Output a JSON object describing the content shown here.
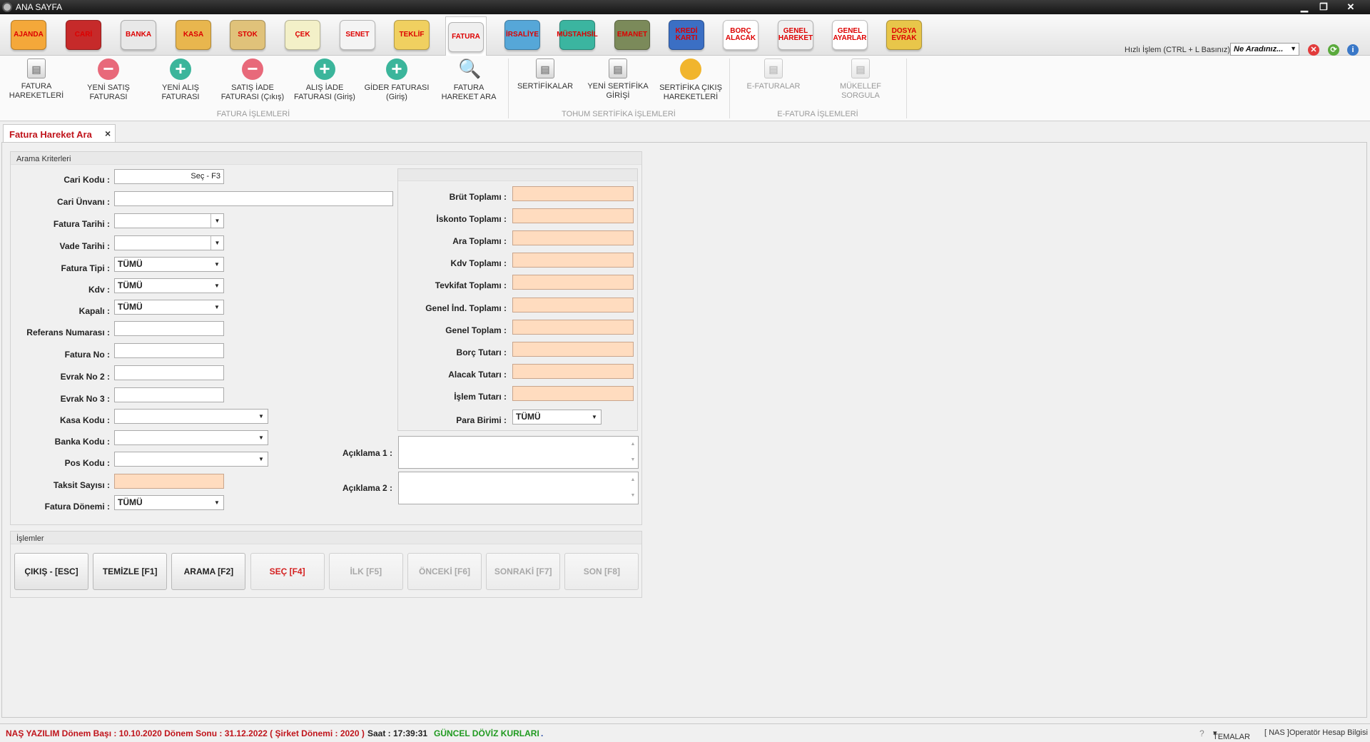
{
  "window": {
    "title": "ANA SAYFA",
    "min": "▁",
    "restore": "❐",
    "close": "✕"
  },
  "modules": [
    {
      "label": "AJANDA",
      "icon": "agenda-icon",
      "color": "#f4a83a"
    },
    {
      "label": "CARİ",
      "icon": "cari-icon",
      "color": "#c62a2a"
    },
    {
      "label": "BANKA",
      "icon": "bank-icon",
      "color": "#e8e8e8"
    },
    {
      "label": "KASA",
      "icon": "cashbox-icon",
      "color": "#e8b64e"
    },
    {
      "label": "STOK",
      "icon": "stock-icon",
      "color": "#e0c27a"
    },
    {
      "label": "ÇEK",
      "icon": "cheque-icon",
      "color": "#f3f0c8"
    },
    {
      "label": "SENET",
      "icon": "note-icon",
      "color": "#f4f4f4"
    },
    {
      "label": "TEKLİF",
      "icon": "offer-icon",
      "color": "#f0d060"
    },
    {
      "label": "FATURA",
      "icon": "invoice-icon",
      "color": "#efefef"
    },
    {
      "label": "İRSALİYE",
      "icon": "waybill-icon",
      "color": "#56a7d8"
    },
    {
      "label": "MÜSTAHSİL",
      "icon": "producer-icon",
      "color": "#3bb5a0"
    },
    {
      "label": "EMANET",
      "icon": "deposit-icon",
      "color": "#7b8a5a"
    },
    {
      "label": "KREDİ KARTI",
      "icon": "credit-card-icon",
      "color": "#3b6fc4"
    },
    {
      "label": "BORÇ ALACAK",
      "icon": "debt-credit-icon",
      "color": "#ffffff"
    },
    {
      "label": "GENEL HAREKET",
      "icon": "general-movement-icon",
      "color": "#f0f0f0"
    },
    {
      "label": "GENEL AYARLAR",
      "icon": "settings-icon",
      "color": "#ffffff"
    },
    {
      "label": "DOSYA EVRAK",
      "icon": "file-icon",
      "color": "#e8c64a"
    }
  ],
  "quick": {
    "label": "Hızlı İşlem  (CTRL + L Basınız):",
    "value": "Ne Aradınız..."
  },
  "ribbon": {
    "fatura_buttons": [
      {
        "label": "FATURA HAREKETLERİ",
        "icon": "document-icon"
      },
      {
        "label": "YENİ SATIŞ FATURASI",
        "icon": "minus-icon"
      },
      {
        "label": "YENİ ALIŞ FATURASI",
        "icon": "plus-icon"
      },
      {
        "label": "SATIŞ İADE FATURASI (Çıkış)",
        "icon": "minus-icon"
      },
      {
        "label": "ALIŞ İADE FATURASI (Giriş)",
        "icon": "plus-icon"
      },
      {
        "label": "GİDER FATURASI (Giriş)",
        "icon": "plus-icon"
      },
      {
        "label": "FATURA HAREKET ARA",
        "icon": "magnifier-icon"
      }
    ],
    "tohum_buttons": [
      {
        "label": "SERTİFİKALAR",
        "icon": "certificate-icon"
      },
      {
        "label": "YENİ SERTİFİKA GİRİŞİ",
        "icon": "new-certificate-icon"
      },
      {
        "label": "SERTİFİKA ÇIKIŞ HAREKETLERİ",
        "icon": "pie-chart-icon"
      }
    ],
    "efatura_buttons": [
      {
        "label": "E-FATURALAR",
        "icon": "e-invoice-icon"
      },
      {
        "label": "MÜKELLEF SORGULA",
        "icon": "taxpayer-query-icon"
      }
    ],
    "groups": {
      "fatura": "FATURA İŞLEMLERİ",
      "tohum": "TOHUM SERTİFİKA İŞLEMLERİ",
      "efatura": "E-FATURA İŞLEMLERİ"
    }
  },
  "tab": {
    "title": "Fatura Hareket Ara",
    "close": "×"
  },
  "search": {
    "title": "Arama Kriterleri",
    "cari_kodu": {
      "label": "Cari Kodu :",
      "hint": "Seç - F3"
    },
    "cari_unvani": {
      "label": "Cari Ünvanı :"
    },
    "fatura_tarihi": {
      "label": "Fatura Tarihi :"
    },
    "vade_tarihi": {
      "label": "Vade Tarihi :"
    },
    "fatura_tipi": {
      "label": "Fatura Tipi :",
      "value": "TÜMÜ"
    },
    "kdv": {
      "label": "Kdv :",
      "value": "TÜMÜ"
    },
    "kapali": {
      "label": "Kapalı :",
      "value": "TÜMÜ"
    },
    "referans": {
      "label": "Referans Numarası :"
    },
    "fatura_no": {
      "label": "Fatura No :"
    },
    "evrak2": {
      "label": "Evrak No 2 :"
    },
    "evrak3": {
      "label": "Evrak No 3 :"
    },
    "kasa": {
      "label": "Kasa Kodu :"
    },
    "banka": {
      "label": "Banka Kodu :"
    },
    "pos": {
      "label": "Pos Kodu :"
    },
    "taksit": {
      "label": "Taksit Sayısı :"
    },
    "donem": {
      "label": "Fatura Dönemi :",
      "value": "TÜMÜ"
    },
    "totals": [
      {
        "label": "Brüt Toplamı :"
      },
      {
        "label": "İskonto Toplamı :"
      },
      {
        "label": "Ara Toplamı :"
      },
      {
        "label": "Kdv Toplamı :"
      },
      {
        "label": "Tevkifat Toplamı :"
      },
      {
        "label": "Genel İnd. Toplamı :"
      },
      {
        "label": "Genel Toplam :"
      },
      {
        "label": "Borç Tutarı :"
      },
      {
        "label": "Alacak Tutarı :"
      },
      {
        "label": "İşlem Tutarı :"
      }
    ],
    "para_birimi": {
      "label": "Para Birimi :",
      "value": "TÜMÜ"
    },
    "aciklama1": {
      "label": "Açıklama 1 :"
    },
    "aciklama2": {
      "label": "Açıklama 2 :"
    }
  },
  "actions": {
    "title": "İşlemler",
    "buttons": [
      {
        "label": "ÇIKIŞ - [ESC]",
        "state": "enabled"
      },
      {
        "label": "TEMİZLE [F1]",
        "state": "enabled"
      },
      {
        "label": "ARAMA [F2]",
        "state": "enabled"
      },
      {
        "label": "SEÇ [F4]",
        "state": "highlight"
      },
      {
        "label": "İLK [F5]",
        "state": "disabled"
      },
      {
        "label": "ÖNCEKİ [F6]",
        "state": "disabled"
      },
      {
        "label": "SONRAKİ [F7]",
        "state": "disabled"
      },
      {
        "label": "SON [F8]",
        "state": "disabled"
      }
    ]
  },
  "status": {
    "period": "NAŞ YAZILIM Dönem Başı : 10.10.2020 Dönem Sonu : 31.12.2022 ( Şirket Dönemi : 2020 )",
    "time": "Saat : 17:39:31",
    "fx": "GÜNCEL DÖVİZ KURLARI",
    "dot": ".",
    "themes": "TEMALAR",
    "operator": "[ NAS ]Operatör Hesap Bilgisi"
  },
  "colors": {
    "accent_red": "#c0141b",
    "peach": "#ffdcbf",
    "status_green": "#1f9a1f"
  }
}
